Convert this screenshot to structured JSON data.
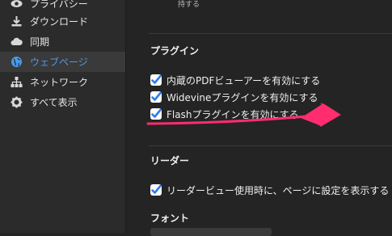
{
  "sidebar": {
    "items": [
      {
        "label": "プライバシー",
        "icon": "eye-icon"
      },
      {
        "label": "ダウンロード",
        "icon": "download-icon"
      },
      {
        "label": "同期",
        "icon": "cloud-icon"
      },
      {
        "label": "ウェブページ",
        "icon": "globe-icon"
      },
      {
        "label": "ネットワーク",
        "icon": "network-icon"
      },
      {
        "label": "すべて表示",
        "icon": "gear-icon"
      }
    ]
  },
  "main": {
    "top_partial_text": "持する",
    "plugins": {
      "heading": "プラグイン",
      "options": [
        {
          "label": "内蔵のPDFビューアーを有効にする",
          "checked": true
        },
        {
          "label": "Widevineプラグインを有効にする",
          "checked": true
        },
        {
          "label": "Flashプラグインを有効にする",
          "checked": true
        }
      ]
    },
    "reader": {
      "heading": "リーダー",
      "options": [
        {
          "label": "リーダービュー使用時に、ページに設定を表示する",
          "checked": true
        }
      ]
    },
    "fonts": {
      "heading": "フォント"
    }
  },
  "colors": {
    "accent": "#4a9bea",
    "checkbox_check": "#2b7de9",
    "annotation": "#ff2d6f"
  }
}
